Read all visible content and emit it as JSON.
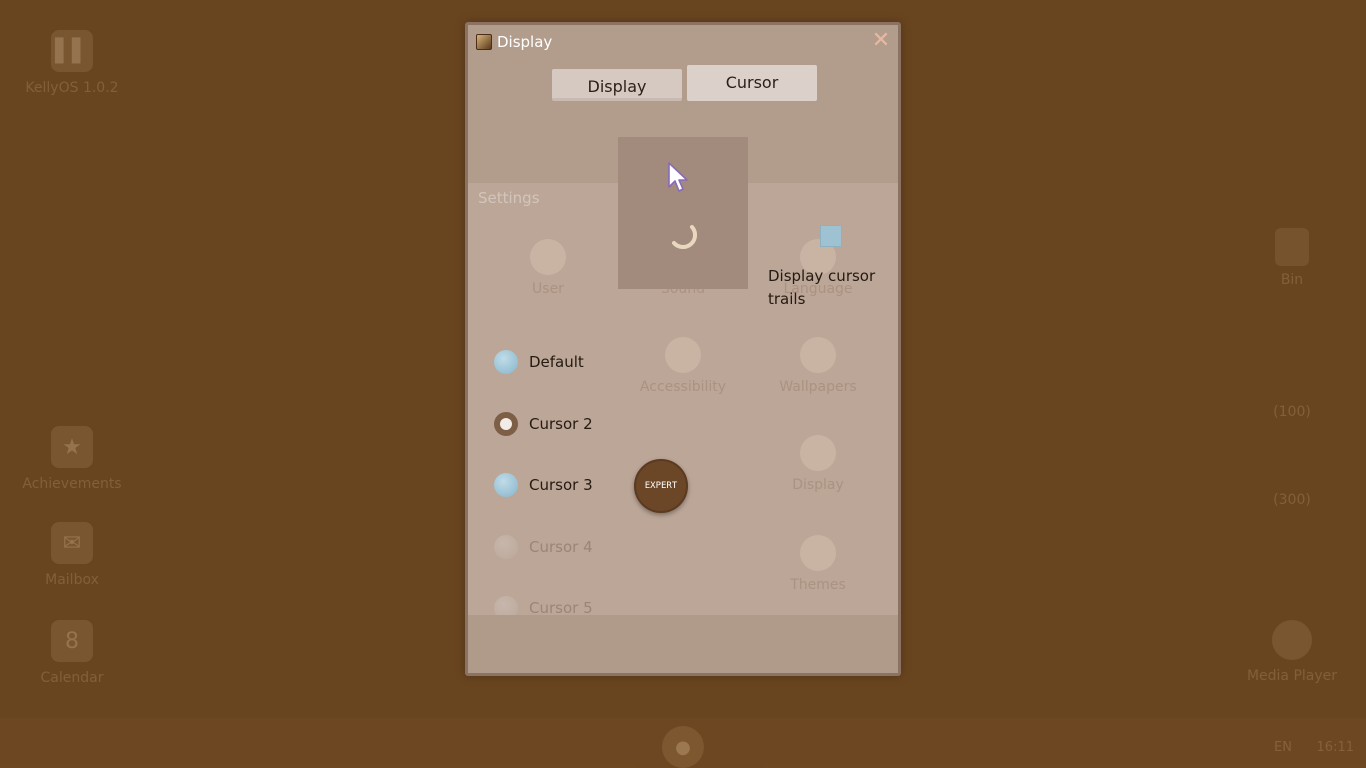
{
  "desktop": {
    "left_icons": [
      {
        "label": "KellyOS 1.0.2",
        "glyph": "▌▌"
      },
      {
        "label": "Achievements",
        "glyph": "★"
      },
      {
        "label": "Mailbox",
        "glyph": "✉"
      },
      {
        "label": "Calendar",
        "glyph": "8"
      }
    ],
    "right_items": {
      "bin": "Bin",
      "value_a": "(100)",
      "value_b": "(300)",
      "media_player": "Media Player"
    },
    "taskbar": {
      "lang": "EN",
      "clock": "16:11"
    }
  },
  "window": {
    "title": "Display",
    "close_glyph": "✕",
    "ghost": {
      "header": "Settings",
      "items": [
        "User",
        "Sound",
        "Language",
        "Accessibility",
        "Wallpapers",
        "Display",
        "Themes"
      ]
    },
    "tabs": [
      {
        "label": "Display",
        "active": false
      },
      {
        "label": "Cursor",
        "active": true
      }
    ],
    "trails_label": "Display cursor trails",
    "options": [
      {
        "label": "Default",
        "state": "normal"
      },
      {
        "label": "Cursor 2",
        "state": "selected"
      },
      {
        "label": "Cursor 3",
        "state": "normal"
      },
      {
        "label": "Cursor 4",
        "state": "disabled"
      },
      {
        "label": "Cursor 5",
        "state": "disabled"
      }
    ],
    "expert_label": "EXPERT"
  },
  "colors": {
    "desktop_bg": "#69451f",
    "window_bg": "#b29c8c",
    "radio_accent": "#86b4ca",
    "selected_radio": "#7d5e46",
    "expert_button": "#6b4627"
  }
}
